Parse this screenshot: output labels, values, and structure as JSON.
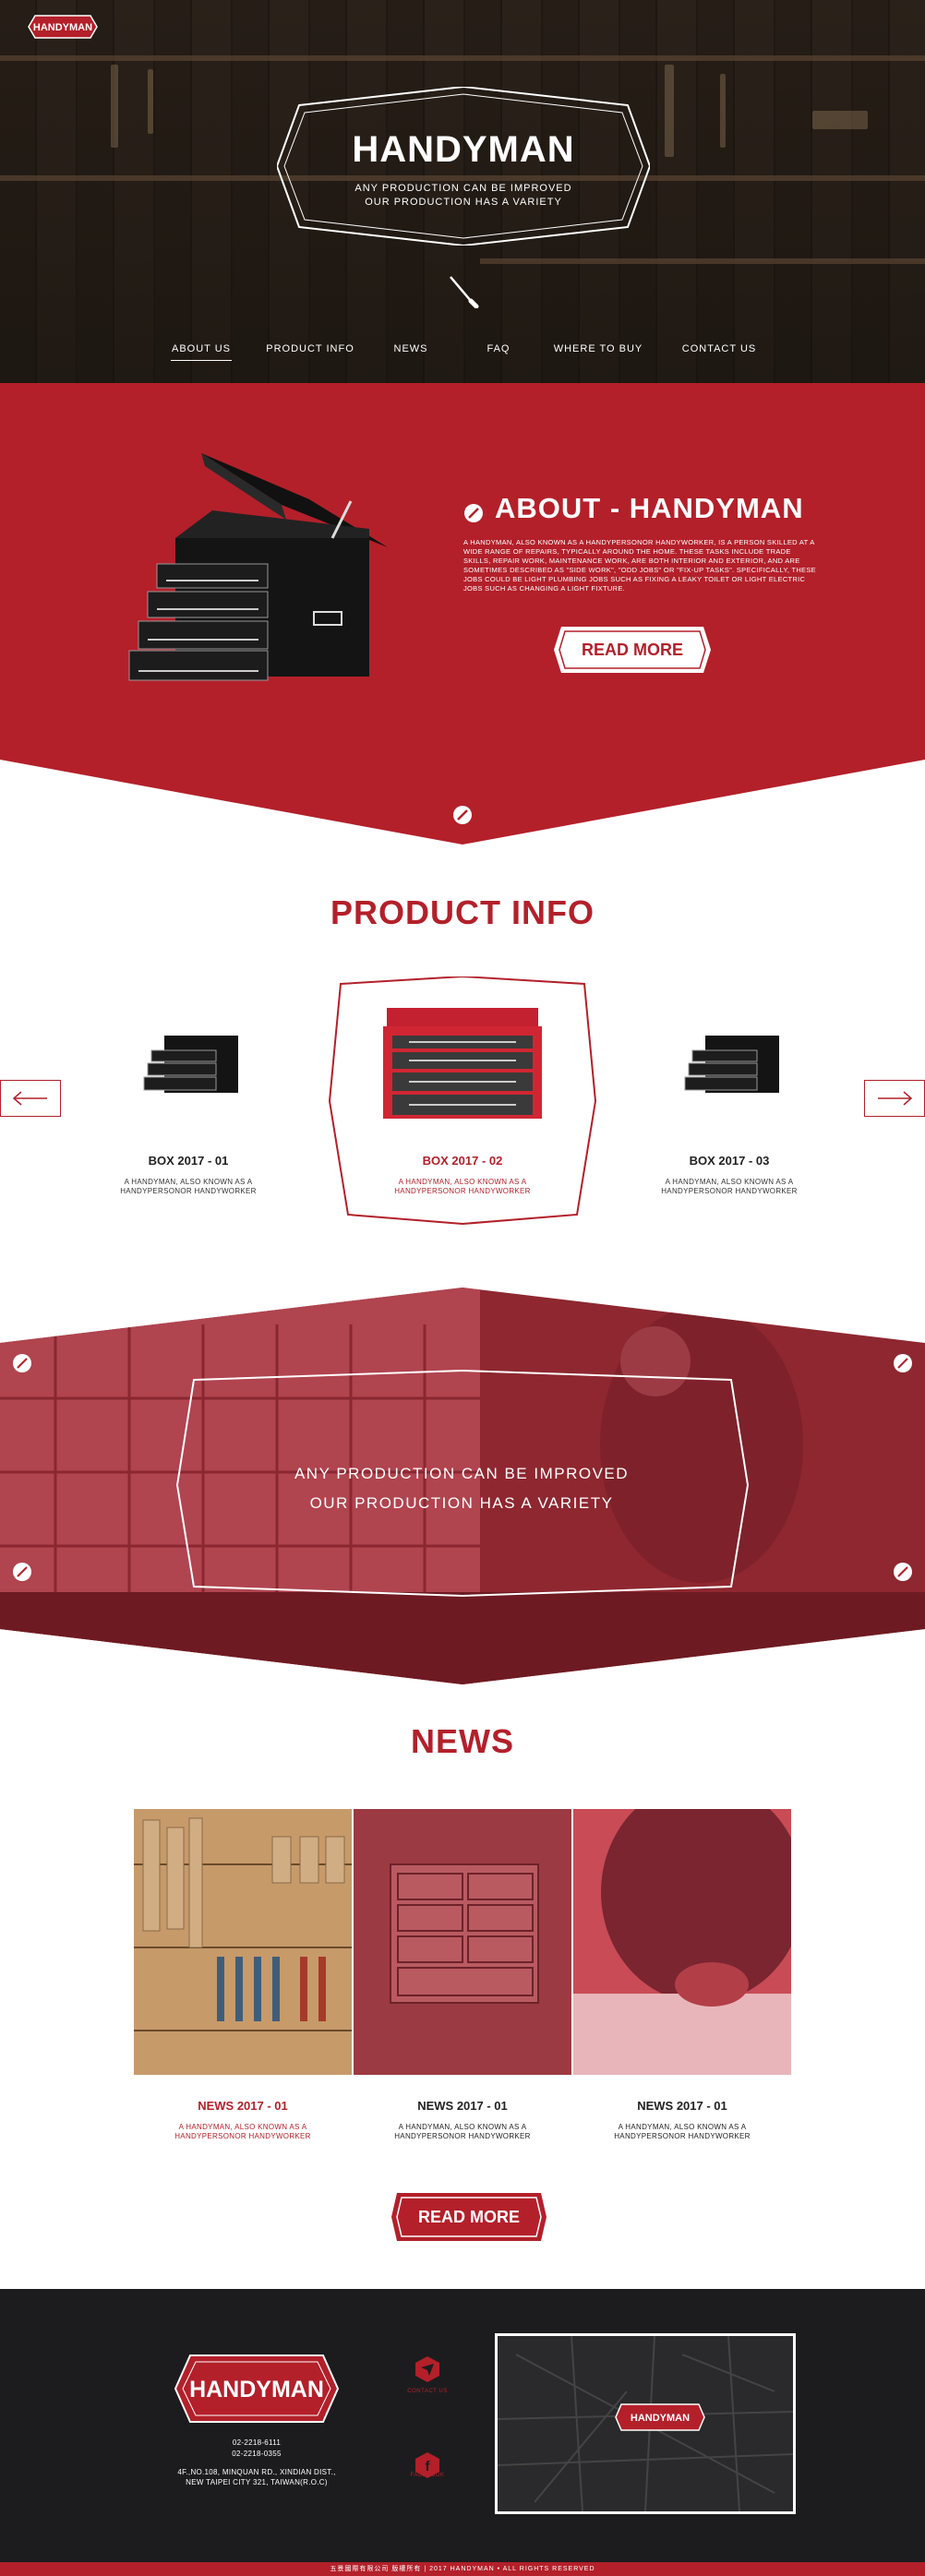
{
  "colors": {
    "brand_red": "#b3202a",
    "dark": "#1c1c1e",
    "white": "#ffffff"
  },
  "logo_text": "HANDYMAN",
  "hero": {
    "title": "HANDYMAN",
    "subtitle_line1": "ANY PRODUCTION CAN BE IMPROVED",
    "subtitle_line2": "OUR PRODUCTION HAS A VARIETY",
    "icon": "screwdriver-icon"
  },
  "nav": [
    {
      "label": "ABOUT US",
      "active": true
    },
    {
      "label": "PRODUCT INFO",
      "active": false
    },
    {
      "label": "NEWS",
      "active": false
    },
    {
      "label": "FAQ",
      "active": false
    },
    {
      "label": "WHERE TO BUY",
      "active": false
    },
    {
      "label": "CONTACT US",
      "active": false
    }
  ],
  "about": {
    "title": "ABOUT - HANDYMAN",
    "text": "A HANDYMAN, ALSO KNOWN AS A HANDYPERSONOR HANDYWORKER, IS A PERSON SKILLED AT A WIDE RANGE OF REPAIRS, TYPICALLY AROUND THE HOME. THESE TASKS INCLUDE TRADE SKILLS, REPAIR WORK, MAINTENANCE WORK, ARE BOTH INTERIOR AND EXTERIOR, AND ARE SOMETIMES DESCRIBED AS \"SIDE WORK\", \"ODD JOBS\" OR \"FIX-UP TASKS\". SPECIFICALLY, THESE JOBS COULD BE LIGHT PLUMBING JOBS SUCH AS FIXING A LEAKY TOILET OR LIGHT ELECTRIC JOBS SUCH AS CHANGING A LIGHT FIXTURE.",
    "button": "READ MORE"
  },
  "product": {
    "title": "PRODUCT INFO",
    "items": [
      {
        "name": "BOX 2017 - 01",
        "desc_line1": "A HANDYMAN, ALSO KNOWN AS A",
        "desc_line2": "HANDYPERSONOR HANDYWORKER"
      },
      {
        "name": "BOX 2017 - 02",
        "desc_line1": "A HANDYMAN, ALSO KNOWN AS A",
        "desc_line2": "HANDYPERSONOR HANDYWORKER"
      },
      {
        "name": "BOX 2017 - 03",
        "desc_line1": "A HANDYMAN, ALSO KNOWN AS A",
        "desc_line2": "HANDYPERSONOR HANDYWORKER"
      }
    ],
    "prev_icon": "arrow-left-icon",
    "next_icon": "arrow-right-icon"
  },
  "banner": {
    "line1": "ANY PRODUCTION CAN BE IMPROVED",
    "line2": "OUR PRODUCTION HAS A VARIETY"
  },
  "news": {
    "title": "NEWS",
    "items": [
      {
        "name": "NEWS 2017 - 01",
        "desc_line1": "A HANDYMAN, ALSO KNOWN AS A",
        "desc_line2": "HANDYPERSONOR HANDYWORKER"
      },
      {
        "name": "NEWS 2017 - 01",
        "desc_line1": "A HANDYMAN, ALSO KNOWN AS A",
        "desc_line2": "HANDYPERSONOR HANDYWORKER"
      },
      {
        "name": "NEWS 2017 - 01",
        "desc_line1": "A HANDYMAN, ALSO KNOWN AS A",
        "desc_line2": "HANDYPERSONOR HANDYWORKER"
      }
    ],
    "button": "READ MORE"
  },
  "footer": {
    "phone1": "02-2218-6111",
    "phone2": "02-2218-0355",
    "address_line1": "4F.,NO.108, MINQUAN RD., XINDIAN DIST.,",
    "address_line2": "NEW TAIPEI CITY 321, TAIWAN(R.O.C)",
    "contact_label": "CONTACT US",
    "facebook_label": "FACEBOOK",
    "map_label": "HANDYMAN",
    "copyright": "五景國際有限公司 版權所有 | 2017 HANDYMAN • ALL RIGHTS RESERVED"
  }
}
